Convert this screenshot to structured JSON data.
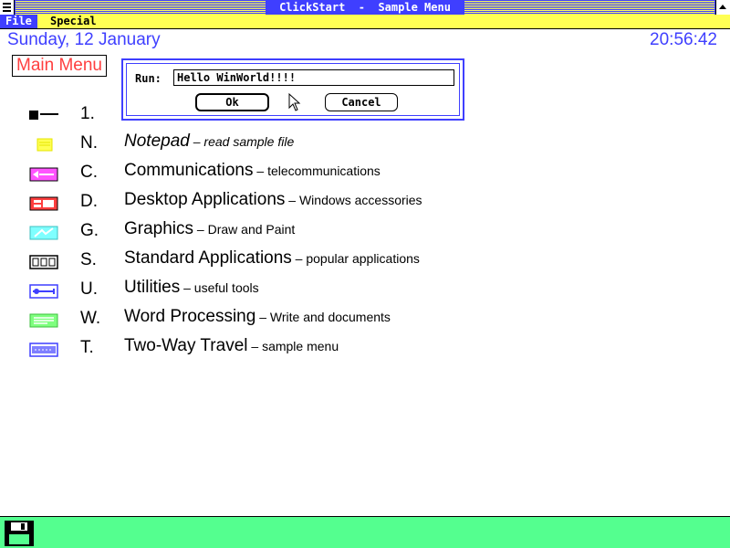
{
  "window": {
    "title": "ClickStart  -  Sample Menu"
  },
  "menubar": {
    "file": "File",
    "special": "Special"
  },
  "header": {
    "date": "Sunday, 12 January",
    "time": "20:56:42"
  },
  "main_menu_label": "Main Menu",
  "menu_items": [
    {
      "key": "1.",
      "name": "",
      "description": "",
      "icon": "selected-item-icon"
    },
    {
      "key": "N.",
      "name": "Notepad",
      "description": " – read sample file",
      "icon": "notepad-icon"
    },
    {
      "key": "C.",
      "name": "Communications",
      "description": " – telecommunications",
      "icon": "communications-icon"
    },
    {
      "key": "D.",
      "name": "Desktop Applications",
      "description": " – Windows accessories",
      "icon": "desktop-icon"
    },
    {
      "key": "G.",
      "name": "Graphics",
      "description": " – Draw and Paint",
      "icon": "graphics-icon"
    },
    {
      "key": "S.",
      "name": "Standard Applications",
      "description": " – popular applications",
      "icon": "standard-icon"
    },
    {
      "key": "U.",
      "name": "Utilities",
      "description": " – useful tools",
      "icon": "utilities-icon"
    },
    {
      "key": "W.",
      "name": "Word Processing",
      "description": " – Write and documents",
      "icon": "wordprocessing-icon"
    },
    {
      "key": "T.",
      "name": "Two-Way Travel",
      "description": " – sample menu",
      "icon": "travel-icon"
    }
  ],
  "dialog": {
    "run_label": "Run:",
    "run_value": "Hello WinWorld!!!!",
    "ok_label": "Ok",
    "cancel_label": "Cancel"
  },
  "colors": {
    "title_blue": "#3f3fff",
    "menu_yellow": "#ffff54",
    "status_green": "#54ff8f",
    "accent_red": "#ff3f3f"
  },
  "bottom_bar": {
    "icon": "floppy-disk-icon"
  }
}
